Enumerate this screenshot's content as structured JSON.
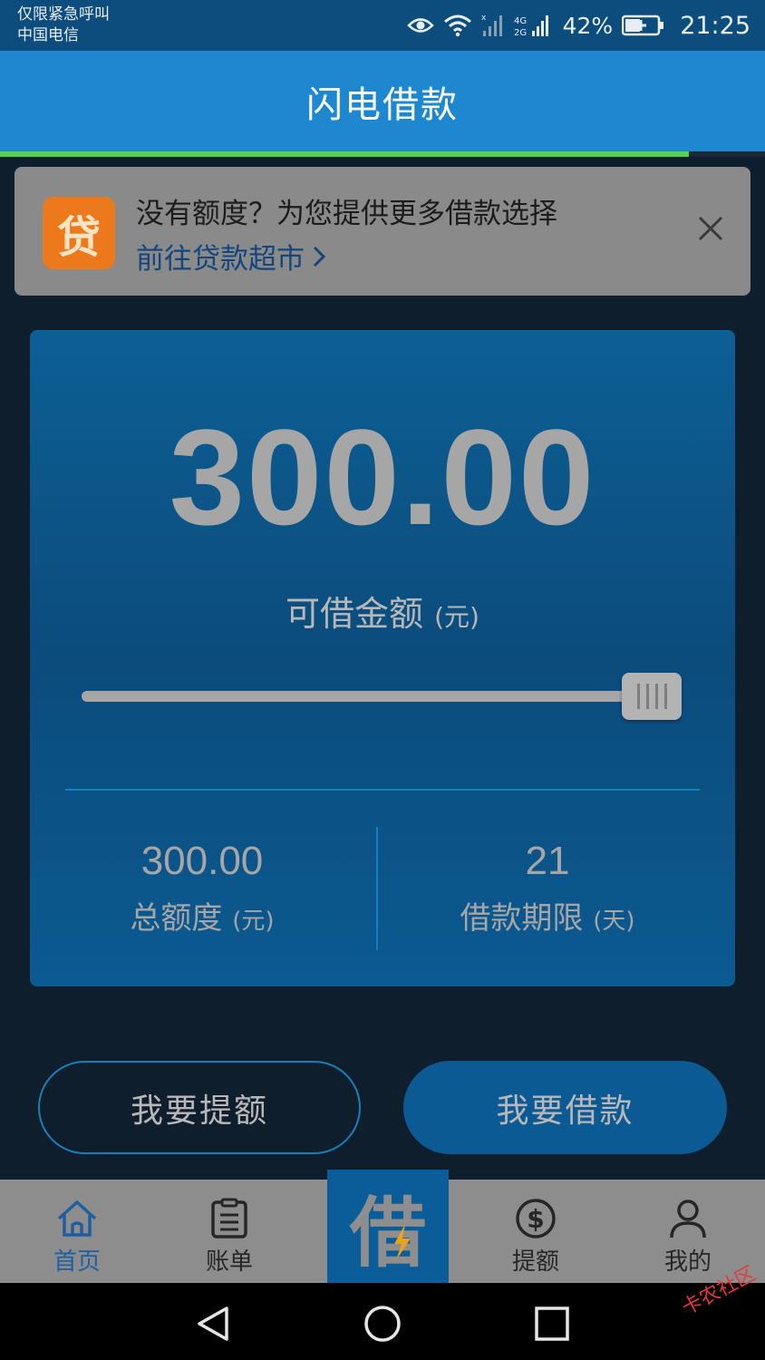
{
  "status_bar": {
    "line1": "仅限紧急呼叫",
    "line2": "中国电信",
    "network": "4G 2G",
    "battery_pct": "42%",
    "time": "21:25"
  },
  "header": {
    "title": "闪电借款",
    "progress": 0.9
  },
  "banner": {
    "logo_text": "贷",
    "message": "没有额度？为您提供更多借款选择",
    "link": "前往贷款超市"
  },
  "card": {
    "amount": "300.00",
    "amount_label": "可借金额",
    "amount_unit": "(元)",
    "slider_value": 1.0,
    "total_value": "300.00",
    "total_label": "总额度",
    "total_unit": "(元)",
    "term_value": "21",
    "term_label": "借款期限",
    "term_unit": "(天)"
  },
  "buttons": {
    "raise_limit": "我要提额",
    "borrow": "我要借款"
  },
  "tabbar": {
    "home": "首页",
    "bills": "账单",
    "center": "借",
    "raise": "提额",
    "mine": "我的"
  },
  "watermark": "卡农社区",
  "colors": {
    "header": "#1d87d0",
    "progress": "#56d24a",
    "card": "#0d5f95",
    "tab_active": "#1f5fa0"
  }
}
